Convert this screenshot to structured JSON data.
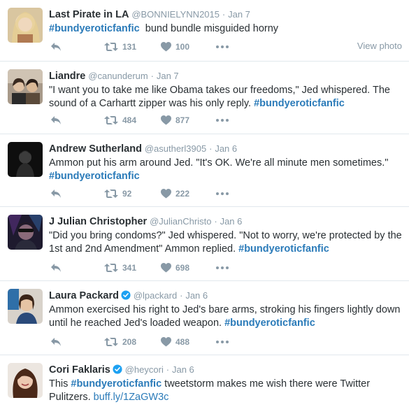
{
  "tweets": [
    {
      "fullname": "Last Pirate in LA",
      "username": "@BONNIELYNN2015",
      "dot": "·",
      "time": "Jan 7",
      "verified": false,
      "text_parts": [
        {
          "kind": "hashtag",
          "text": "#bundyeroticfanfic"
        },
        {
          "kind": "plain",
          "text": "  bund bundle misguided horny"
        }
      ],
      "retweets": "131",
      "likes": "100",
      "view_photo": "View photo",
      "avatar_colors": [
        "#c9a47a",
        "#e8d3b0"
      ]
    },
    {
      "fullname": "Liandre",
      "username": "@canunderum",
      "dot": "·",
      "time": "Jan 7",
      "verified": false,
      "text_parts": [
        {
          "kind": "plain",
          "text": "\"I want you to take me like Obama takes our freedoms,\" Jed whispered. The sound of a Carhartt zipper was his only reply. "
        },
        {
          "kind": "hashtag",
          "text": "#bundyeroticfanfic"
        }
      ],
      "retweets": "484",
      "likes": "877",
      "avatar_colors": [
        "#6a5a4c",
        "#c9b8a5"
      ]
    },
    {
      "fullname": "Andrew Sutherland",
      "username": "@asutherl3905",
      "dot": "·",
      "time": "Jan 6",
      "verified": false,
      "text_parts": [
        {
          "kind": "plain",
          "text": "Ammon put his arm around Jed. \"It's OK. We're all minute men sometimes.\" "
        },
        {
          "kind": "hashtag",
          "text": "#bundyeroticfanfic"
        }
      ],
      "retweets": "92",
      "likes": "222",
      "avatar_colors": [
        "#111111",
        "#3a3a3a"
      ]
    },
    {
      "fullname": "J Julian Christopher",
      "username": "@JulianChristo",
      "dot": "·",
      "time": "Jan 6",
      "verified": false,
      "text_parts": [
        {
          "kind": "plain",
          "text": "\"Did you bring condoms?\" Jed whispered. \"Not to worry, we're protected by the 1st and 2nd Amendment\" Ammon replied. "
        },
        {
          "kind": "hashtag",
          "text": "#bundyeroticfanfic"
        }
      ],
      "retweets": "341",
      "likes": "698",
      "avatar_colors": [
        "#2a2340",
        "#7a3a8a"
      ]
    },
    {
      "fullname": "Laura Packard",
      "username": "@lpackard",
      "dot": "·",
      "time": "Jan 6",
      "verified": true,
      "text_parts": [
        {
          "kind": "plain",
          "text": "Ammon exercised his right to Jed's bare arms, stroking his fingers lightly down until he reached Jed's loaded weapon. "
        },
        {
          "kind": "hashtag",
          "text": "#bundyeroticfanfic"
        }
      ],
      "retweets": "208",
      "likes": "488",
      "avatar_colors": [
        "#2f6fa8",
        "#d8d0c8"
      ]
    },
    {
      "fullname": "Cori Faklaris",
      "username": "@heycori",
      "dot": "·",
      "time": "Jan 6",
      "verified": true,
      "text_parts": [
        {
          "kind": "plain",
          "text": "This "
        },
        {
          "kind": "hashtag",
          "text": "#bundyeroticfanfic"
        },
        {
          "kind": "plain",
          "text": " tweetstorm makes me wish there were Twitter Pulitzers. "
        },
        {
          "kind": "link",
          "text": "buff.ly/1ZaGW3c"
        }
      ],
      "avatar_colors": [
        "#5a3a2a",
        "#e0c8b8"
      ]
    }
  ],
  "colors": {
    "link": "#2b7bb9",
    "muted": "#8899a6",
    "verified": "#1da1f2",
    "border": "#e1e8ed"
  },
  "icons": [
    "reply-icon",
    "retweet-icon",
    "like-icon",
    "more-icon",
    "verified-icon"
  ]
}
